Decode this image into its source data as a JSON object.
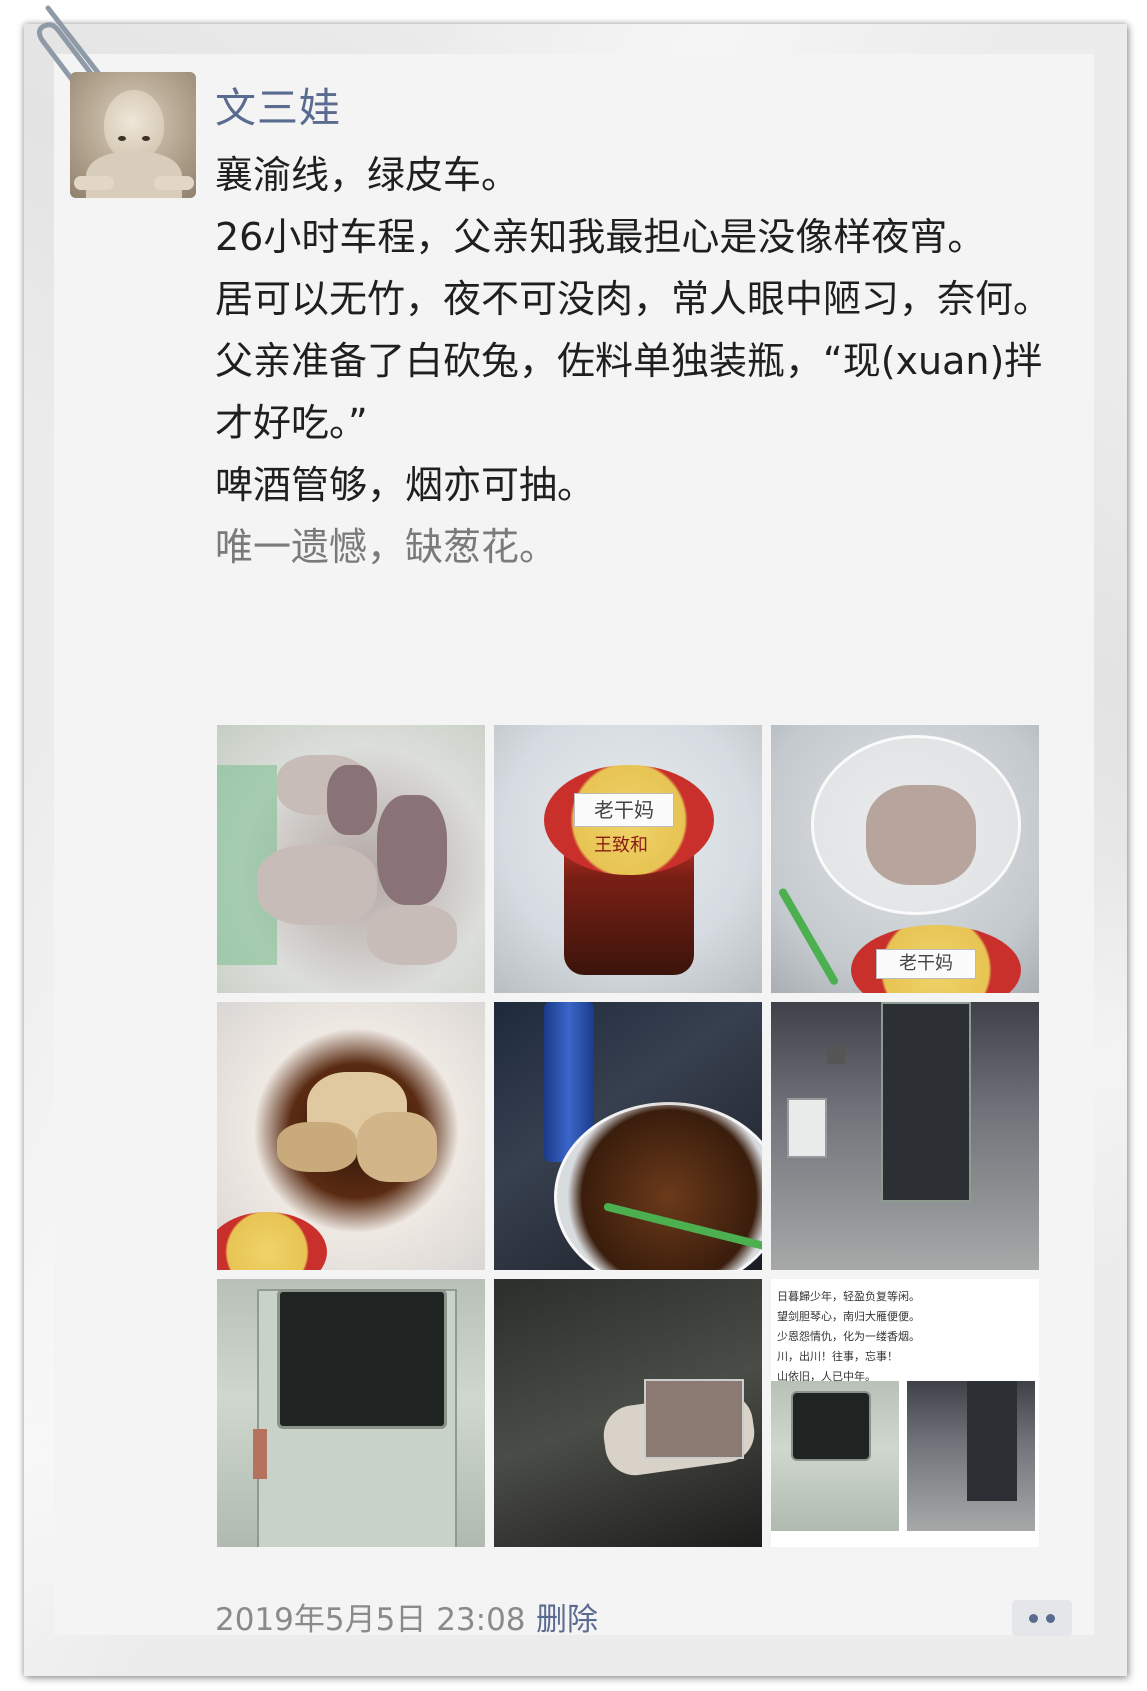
{
  "post": {
    "author": "文三娃",
    "lines": [
      "襄渝线，绿皮车。",
      "26小时车程，父亲知我最担心是没像样夜宵。",
      "居可以无竹，夜不可没肉，常人眼中陋习，奈何。",
      "父亲准备了白砍兔，佐料单独装瓶，“现(xuan)拌才好吃。”",
      "啤酒管够，烟亦可抽。",
      "唯一遗憾，缺葱花。"
    ],
    "timestamp": "2019年5月5日 23:08",
    "delete_label": "删除"
  },
  "photos": {
    "jar_label_1": "老干妈",
    "jar_brand": "王致和",
    "jar_label_2": "老干妈",
    "poem_lines": [
      "日暮歸少年，轻盈负复等闲。",
      "望剑胆琴心，南归大雁便便。",
      "少恩怨情仇，化为一缕香烟。",
      "川，出川！往事，忘事！",
      "山依旧，人已中年。"
    ]
  },
  "colors": {
    "name_link": "#5a6b90",
    "body_text": "#1f1f1f",
    "faded_text": "#7a7a7a",
    "meta_text": "#8a8a8a"
  },
  "icons": {
    "clip": "paperclip-icon",
    "more": "more-dots-icon"
  }
}
